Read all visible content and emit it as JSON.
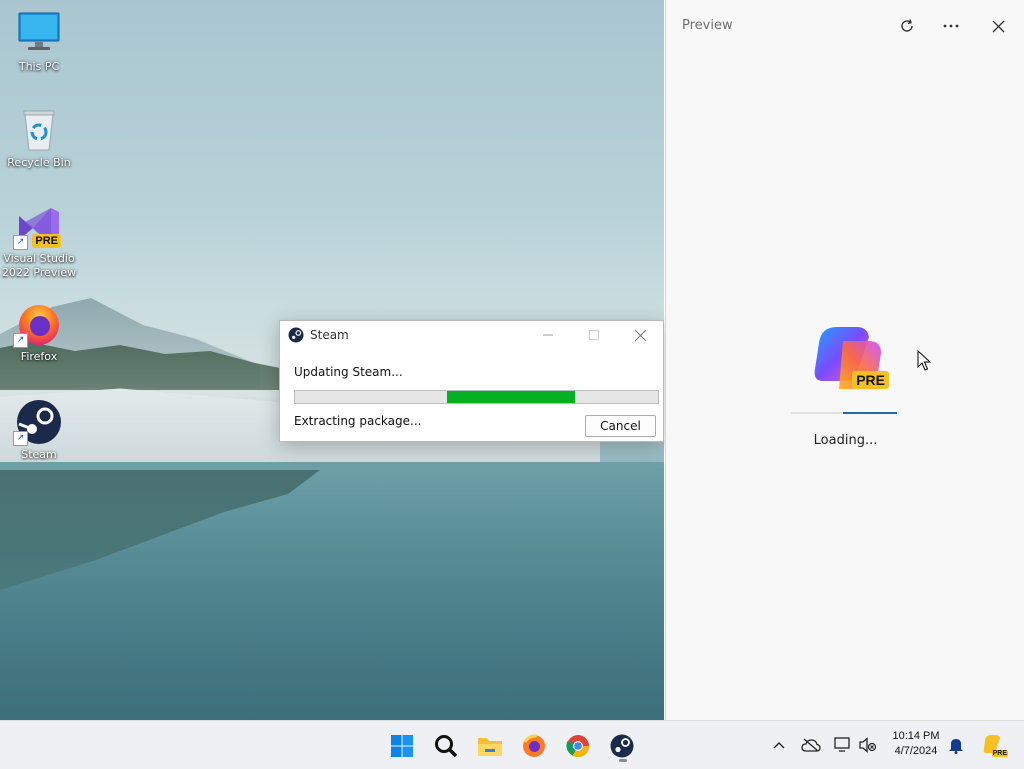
{
  "desktop": {
    "icons": [
      {
        "label": "This PC"
      },
      {
        "label": "Recycle Bin"
      },
      {
        "label": "Visual Studio 2022 Preview",
        "badge": "PRE"
      },
      {
        "label": "Firefox"
      },
      {
        "label": "Steam"
      }
    ]
  },
  "steam_dialog": {
    "title": "Steam",
    "status": "Updating Steam...",
    "substatus": "Extracting package...",
    "cancel_label": "Cancel",
    "progress_start": 0.42,
    "progress_end": 0.77,
    "progress_color": "#06b025"
  },
  "preview_pane": {
    "title": "Preview",
    "loading_text": "Loading...",
    "badge": "PRE",
    "icons": [
      "refresh-icon",
      "more-icon",
      "close-icon"
    ]
  },
  "taskbar": {
    "apps": [
      "start-icon",
      "search-icon",
      "file-explorer-icon",
      "firefox-icon",
      "chrome-icon",
      "steam-icon"
    ],
    "clock_time": "10:14 PM",
    "clock_date": "4/7/2024",
    "tray_badge": "PRE"
  }
}
